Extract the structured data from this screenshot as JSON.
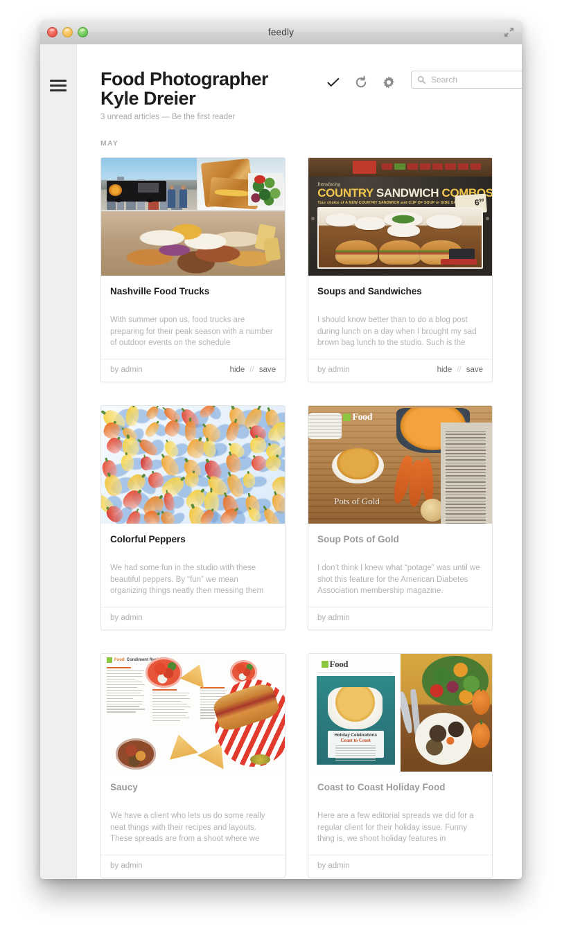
{
  "window": {
    "title": "feedly",
    "controls": {
      "close": "close-window",
      "minimize": "minimize-window",
      "zoom": "zoom-window"
    },
    "resize_icon": "fullscreen-icon"
  },
  "sidebar": {
    "menu_icon": "hamburger-icon"
  },
  "header": {
    "title": "Food Photographer Kyle Dreier",
    "subtitle": "3 unread articles — Be the first reader",
    "tools": [
      {
        "name": "mark-all-read-button",
        "icon": "check-icon"
      },
      {
        "name": "refresh-button",
        "icon": "refresh-icon"
      },
      {
        "name": "settings-button",
        "icon": "gear-icon"
      }
    ],
    "search": {
      "placeholder": "Search",
      "value": "",
      "icon": "search-icon"
    }
  },
  "section": {
    "month_label": "MAY"
  },
  "footer_actions": {
    "hide": "hide",
    "separator": "//",
    "save": "save"
  },
  "cards": [
    {
      "title": "Nashville Food Trucks",
      "snippet": "With summer upon us, food trucks are preparing for their peak season with a number of outdoor events on the schedule",
      "author": "by admin",
      "read": false,
      "has_actions": true,
      "thumb": "nashville-food-trucks-collage"
    },
    {
      "title": "Soups and Sandwiches",
      "snippet": "I should know better than to do a blog post during lunch on a day when I brought my sad brown bag lunch to the studio. Such is the",
      "author": "by admin",
      "read": false,
      "has_actions": true,
      "thumb": "country-sandwich-combos-webpage"
    },
    {
      "title": "Colorful Peppers",
      "snippet": "We had some fun in the studio with these beautiful peppers. By “fun” we mean organizing things neatly then messing them",
      "author": "by admin",
      "read": false,
      "has_actions": false,
      "thumb": "colorful-peppers-photo"
    },
    {
      "title": "Soup Pots of Gold",
      "snippet": "I don’t think I knew what “potage” was until we shot this feature for the American Diabetes Association membership magazine.",
      "author": "by admin",
      "read": true,
      "has_actions": false,
      "thumb": "pots-of-gold-magazine-spread"
    },
    {
      "title": "Saucy",
      "snippet": "We have a client who lets us do some really neat things with their recipes and layouts. These spreads are from a shoot where we",
      "author": "by admin",
      "read": true,
      "has_actions": false,
      "thumb": "condiment-recipes-magazine-spread"
    },
    {
      "title": "Coast to Coast Holiday Food",
      "snippet": "Here are a few editorial spreads we did for a regular client for their holiday issue. Funny thing is, we shoot holiday features in",
      "author": "by admin",
      "read": true,
      "has_actions": false,
      "thumb": "holiday-celebrations-magazine-spread"
    }
  ],
  "thumb_art": {
    "country_combos": {
      "intro": "Introducing",
      "headline_1": "COUNTRY ",
      "headline_2": "SANDWICH",
      "headline_3": " COMBOS",
      "tagline": "Your choice of A NEW COUNTRY SANDWICH and CUP OF SOUP or SIDE SALAD",
      "price": "6"
    },
    "pots_of_gold": {
      "logo": "Food",
      "headline": "Pots of Gold"
    },
    "condiment": {
      "logo": "Food",
      "kicker": "Condiment Recipes"
    },
    "holiday": {
      "logo": "Food",
      "caption_1": "Holiday Celebrations",
      "caption_2": "Coast to Coast"
    }
  },
  "colors": {
    "accent_green": "#8cc63e",
    "title_text": "#1b1b1b",
    "muted_text": "#b3b3b3",
    "sidebar_bg": "#efefef"
  }
}
